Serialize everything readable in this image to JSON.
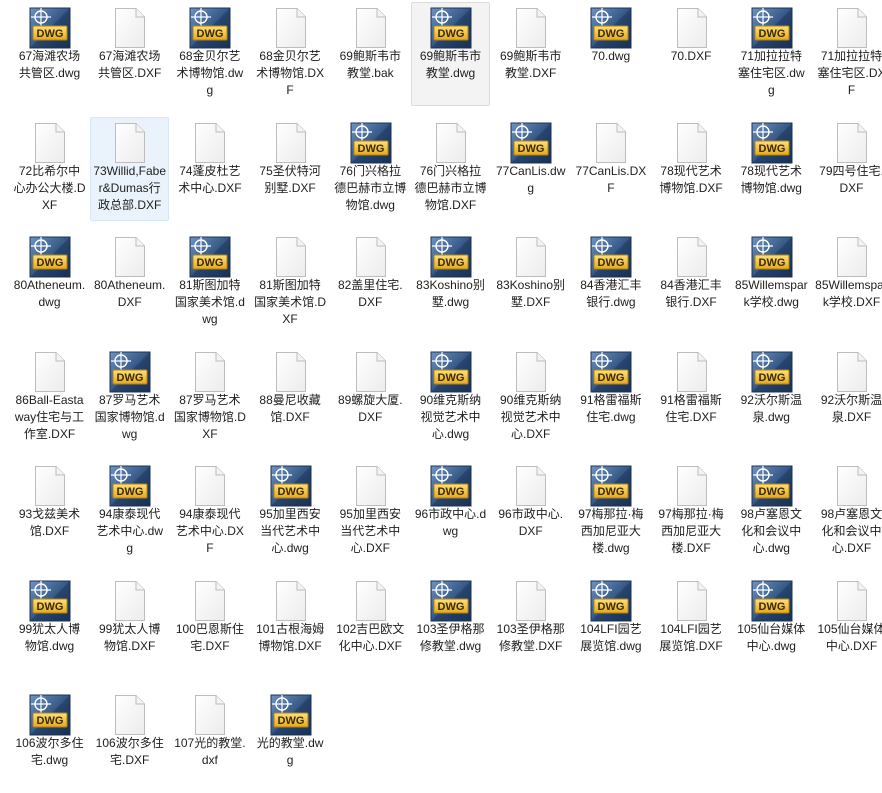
{
  "window": {
    "view": "large-icons"
  },
  "colors": {
    "accent": "#f2c23a",
    "accent_dark": "#b08417",
    "dwg_blue": "#3a5f8f",
    "doc_border": "#c8c8c8"
  },
  "files": [
    {
      "name": "67海滩农场共管区.dwg",
      "icon": "dwg-icon"
    },
    {
      "name": "67海滩农场共管区.DXF",
      "icon": "dxf-file-icon"
    },
    {
      "name": "68金贝尔艺术博物馆.dwg",
      "icon": "dwg-icon"
    },
    {
      "name": "68金贝尔艺术博物馆.DXF",
      "icon": "dxf-file-icon"
    },
    {
      "name": "69鲍斯韦市教堂.bak",
      "icon": "bak-file-icon"
    },
    {
      "name": "69鲍斯韦市教堂.dwg",
      "icon": "dwg-icon"
    },
    {
      "name": "69鲍斯韦市教堂.DXF",
      "icon": "dxf-file-icon"
    },
    {
      "name": "70.dwg",
      "icon": "dwg-icon"
    },
    {
      "name": "70.DXF",
      "icon": "dxf-file-icon"
    },
    {
      "name": "71加拉拉特塞住宅区.dwg",
      "icon": "dwg-icon"
    },
    {
      "name": "71加拉拉特塞住宅区.DXF",
      "icon": "dxf-file-icon"
    },
    {
      "name": "72比希尔中心办公大楼.DXF",
      "icon": "dxf-file-icon"
    },
    {
      "name": "73Willid,Faber&Dumas行政总部.DXF",
      "icon": "dxf-file-icon"
    },
    {
      "name": "74蓬皮杜艺术中心.DXF",
      "icon": "dxf-file-icon"
    },
    {
      "name": "75圣伏特河别墅.DXF",
      "icon": "dxf-file-icon"
    },
    {
      "name": "76门兴格拉德巴赫市立博物馆.dwg",
      "icon": "dwg-icon"
    },
    {
      "name": "76门兴格拉德巴赫市立博物馆.DXF",
      "icon": "dxf-file-icon"
    },
    {
      "name": "77CanLis.dwg",
      "icon": "dwg-icon"
    },
    {
      "name": "77CanLis.DXF",
      "icon": "dxf-file-icon"
    },
    {
      "name": "78现代艺术博物馆.DXF",
      "icon": "dxf-file-icon"
    },
    {
      "name": "78现代艺术博物馆.dwg",
      "icon": "dwg-icon"
    },
    {
      "name": "79四号住宅.DXF",
      "icon": "dxf-file-icon"
    },
    {
      "name": "80Atheneum.dwg",
      "icon": "dwg-icon"
    },
    {
      "name": "80Atheneum.DXF",
      "icon": "dxf-file-icon"
    },
    {
      "name": "81斯图加特国家美术馆.dwg",
      "icon": "dwg-icon"
    },
    {
      "name": "81斯图加特国家美术馆.DXF",
      "icon": "dxf-file-icon"
    },
    {
      "name": "82盖里住宅.DXF",
      "icon": "dxf-file-icon"
    },
    {
      "name": "83Koshino别墅.dwg",
      "icon": "dwg-icon"
    },
    {
      "name": "83Koshino别墅.DXF",
      "icon": "dxf-file-icon"
    },
    {
      "name": "84香港汇丰银行.dwg",
      "icon": "dwg-icon"
    },
    {
      "name": "84香港汇丰银行.DXF",
      "icon": "dxf-file-icon"
    },
    {
      "name": "85Willemspark学校.dwg",
      "icon": "dwg-icon"
    },
    {
      "name": "85Willemspark学校.DXF",
      "icon": "dxf-file-icon"
    },
    {
      "name": "86Ball-Eastaway住宅与工作室.DXF",
      "icon": "dxf-file-icon"
    },
    {
      "name": "87罗马艺术国家博物馆.dwg",
      "icon": "dwg-icon"
    },
    {
      "name": "87罗马艺术国家博物馆.DXF",
      "icon": "dxf-file-icon"
    },
    {
      "name": "88曼尼收藏馆.DXF",
      "icon": "dxf-file-icon"
    },
    {
      "name": "89螺旋大厦.DXF",
      "icon": "dxf-file-icon"
    },
    {
      "name": "90维克斯纳视觉艺术中心.dwg",
      "icon": "dwg-icon"
    },
    {
      "name": "90维克斯纳视觉艺术中心.DXF",
      "icon": "dxf-file-icon"
    },
    {
      "name": "91格雷福斯住宅.dwg",
      "icon": "dwg-icon"
    },
    {
      "name": "91格雷福斯住宅.DXF",
      "icon": "dxf-file-icon"
    },
    {
      "name": "92沃尔斯温泉.dwg",
      "icon": "dwg-icon"
    },
    {
      "name": "92沃尔斯温泉.DXF",
      "icon": "dxf-file-icon"
    },
    {
      "name": "93戈兹美术馆.DXF",
      "icon": "dxf-file-icon"
    },
    {
      "name": "94康泰现代艺术中心.dwg",
      "icon": "dwg-icon"
    },
    {
      "name": "94康泰现代艺术中心.DXF",
      "icon": "dxf-file-icon"
    },
    {
      "name": "95加里西安当代艺术中心.dwg",
      "icon": "dwg-icon"
    },
    {
      "name": "95加里西安当代艺术中心.DXF",
      "icon": "dxf-file-icon"
    },
    {
      "name": "96市政中心.dwg",
      "icon": "dwg-icon"
    },
    {
      "name": "96市政中心.DXF",
      "icon": "dxf-file-icon"
    },
    {
      "name": "97梅那拉·梅西加尼亚大楼.dwg",
      "icon": "dwg-icon"
    },
    {
      "name": "97梅那拉·梅西加尼亚大楼.DXF",
      "icon": "dxf-file-icon"
    },
    {
      "name": "98卢塞恩文化和会议中心.dwg",
      "icon": "dwg-icon"
    },
    {
      "name": "98卢塞恩文化和会议中心.DXF",
      "icon": "dxf-file-icon"
    },
    {
      "name": "99犹太人博物馆.dwg",
      "icon": "dwg-icon"
    },
    {
      "name": "99犹太人博物馆.DXF",
      "icon": "dxf-file-icon"
    },
    {
      "name": "100巴恩斯住宅.DXF",
      "icon": "dxf-file-icon"
    },
    {
      "name": "101古根海姆博物馆.DXF",
      "icon": "dxf-file-icon"
    },
    {
      "name": "102吉巴欧文化中心.DXF",
      "icon": "dxf-file-icon"
    },
    {
      "name": "103圣伊格那修教堂.dwg",
      "icon": "dwg-icon"
    },
    {
      "name": "103圣伊格那修教堂.DXF",
      "icon": "dxf-file-icon"
    },
    {
      "name": "104LFI园艺展览馆.dwg",
      "icon": "dwg-icon"
    },
    {
      "name": "104LFI园艺展览馆.DXF",
      "icon": "dxf-file-icon"
    },
    {
      "name": "105仙台媒体中心.dwg",
      "icon": "dwg-icon"
    },
    {
      "name": "105仙台媒体中心.DXF",
      "icon": "dxf-file-icon"
    },
    {
      "name": "106波尔多住宅.dwg",
      "icon": "dwg-icon"
    },
    {
      "name": "106波尔多住宅.DXF",
      "icon": "dxf-file-icon"
    },
    {
      "name": "107光的教堂.dxf",
      "icon": "dxf-file-icon"
    },
    {
      "name": "光的教堂.dwg",
      "icon": "dwg-icon"
    }
  ],
  "dwg_badge_text": "DWG"
}
